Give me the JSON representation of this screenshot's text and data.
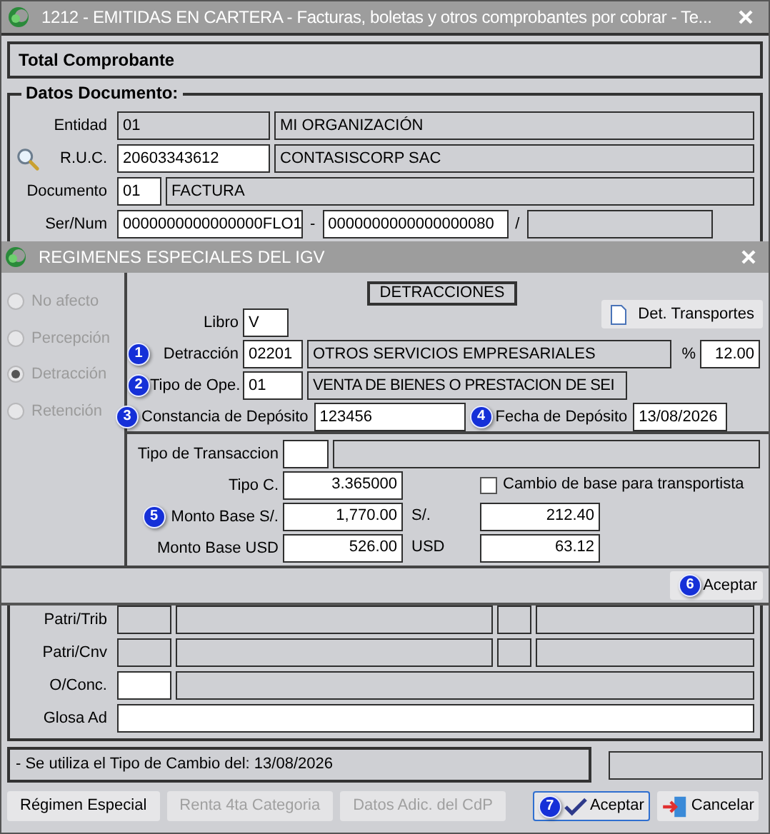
{
  "window": {
    "title": "1212 - EMITIDAS EN CARTERA - Facturas, boletas y otros comprobantes por cobrar - Te..."
  },
  "total_panel": {
    "title": "Total Comprobante"
  },
  "datos_documento": {
    "legend": "Datos Documento:",
    "rows": [
      {
        "label": "Entidad",
        "fields": [
          {
            "value": "01",
            "readonly": true
          },
          {
            "value": "MI ORGANIZACIÓN",
            "readonly": true
          }
        ]
      },
      {
        "label": "R.U.C.",
        "search": true,
        "fields": [
          {
            "value": "20603343612",
            "readonly": false
          },
          {
            "value": "CONTASISCORP SAC",
            "readonly": true
          }
        ]
      },
      {
        "label": "Documento",
        "fields": [
          {
            "value": "01",
            "readonly": false
          },
          {
            "value": "FACTURA",
            "readonly": true
          }
        ]
      },
      {
        "label": "Ser/Num",
        "fields": [
          {
            "value": "0000000000000000FLO1",
            "readonly": false
          },
          {
            "separator": "-",
            "value": "0000000000000000080",
            "readonly": false
          },
          {
            "separator": "/",
            "readonly": true
          }
        ]
      }
    ]
  },
  "lower_rows": [
    {
      "label": "Patri/Trib",
      "fields": [
        {
          "readonly": true
        },
        {
          "readonly": true
        },
        {
          "readonly": true
        },
        {
          "readonly": true
        }
      ]
    },
    {
      "label": "Patri/Cnv",
      "fields": [
        {
          "readonly": true
        },
        {
          "readonly": true
        },
        {
          "readonly": true
        },
        {
          "readonly": true
        }
      ]
    },
    {
      "label": "O/Conc.",
      "fields": [
        {
          "readonly": false
        },
        {
          "readonly": true
        }
      ]
    },
    {
      "label": "Glosa Ad",
      "fields": [
        {
          "readonly": false
        }
      ]
    }
  ],
  "status": {
    "message": "- Se utiliza el Tipo de Cambio del: 13/08/2026"
  },
  "buttons": [
    {
      "label": "Régimen Especial",
      "kind": "plain",
      "disabled": false
    },
    {
      "label": "Renta 4ta Categoria",
      "kind": "plain",
      "disabled": true
    },
    {
      "label": "Datos Adic. del CdP",
      "kind": "plain",
      "disabled": true
    },
    {
      "label": "Aceptar",
      "kind": "accept",
      "disabled": false,
      "badge": "7"
    },
    {
      "label": "Cancelar",
      "kind": "cancel",
      "disabled": false
    }
  ],
  "dialog": {
    "title": "REGIMENES ESPECIALES DEL IGV",
    "regimes": [
      {
        "label": "No afecto",
        "selected": false,
        "disabled": true
      },
      {
        "label": "Percepción",
        "selected": false,
        "disabled": true
      },
      {
        "label": "Detracción",
        "selected": true,
        "disabled": true
      },
      {
        "label": "Retención",
        "selected": false,
        "disabled": true
      }
    ],
    "section_title": "DETRACCIONES",
    "libro": {
      "label": "Libro",
      "value": "V"
    },
    "det_transportes_button": "Det. Transportes",
    "detraccion": {
      "badge": "1",
      "label": "Detracción",
      "code": "02201",
      "description": "OTROS SERVICIOS EMPRESARIALES",
      "percent_label": "%",
      "percent": "12.00"
    },
    "tipo_ope": {
      "badge": "2",
      "label": "Tipo de Ope.",
      "code": "01",
      "description": "VENTA DE BIENES O PRESTACION DE SEI"
    },
    "constancia": {
      "badge": "3",
      "label": "Constancia de Depósito",
      "value": "123456"
    },
    "fecha": {
      "badge": "4",
      "label": "Fecha de Depósito",
      "value": "13/08/2026"
    },
    "tipo_transaccion": {
      "label": "Tipo de Transaccion"
    },
    "tipo_c": {
      "label": "Tipo C.",
      "value": "3.365000"
    },
    "cambio_base": {
      "label": "Cambio de base para transportista",
      "checked": false
    },
    "monto_soles": {
      "badge": "5",
      "label": "Monto Base S/.",
      "value": "1,770.00",
      "unit": "S/.",
      "amount": "212.40"
    },
    "monto_usd": {
      "label": "Monto Base USD",
      "value": "526.00",
      "unit": "USD",
      "amount": "63.12"
    },
    "accept_button": {
      "label": "Aceptar",
      "badge": "6"
    }
  }
}
